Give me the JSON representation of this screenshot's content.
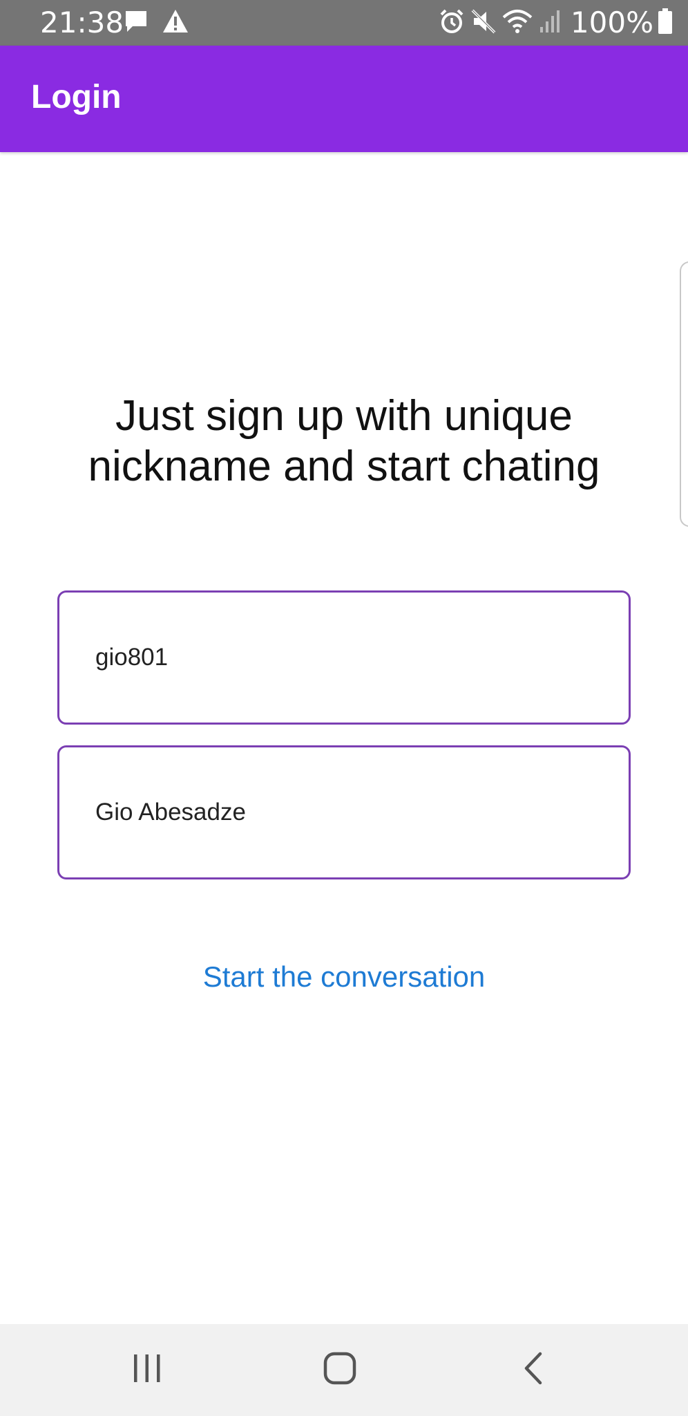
{
  "status_bar": {
    "time": "21:38",
    "battery_percent": "100%",
    "left_icons": [
      "chat-bubble-icon",
      "warning-icon"
    ],
    "right_icons": [
      "alarm-icon",
      "mute-icon",
      "wifi-icon",
      "signal-icon",
      "battery-icon"
    ],
    "background": "#757575"
  },
  "app_bar": {
    "title": "Login",
    "background": "#8a2be2"
  },
  "main": {
    "headline": "Just sign up with unique nickname and start chating",
    "nickname_field": {
      "value": "gio801"
    },
    "fullname_field": {
      "value": "Gio Abesadze"
    },
    "start_link": "Start the conversation",
    "accent_color": "#1e7bd4",
    "field_border_color": "#7b3fb3"
  },
  "nav_bar": {
    "buttons": [
      "recents-icon",
      "home-icon",
      "back-icon"
    ]
  }
}
